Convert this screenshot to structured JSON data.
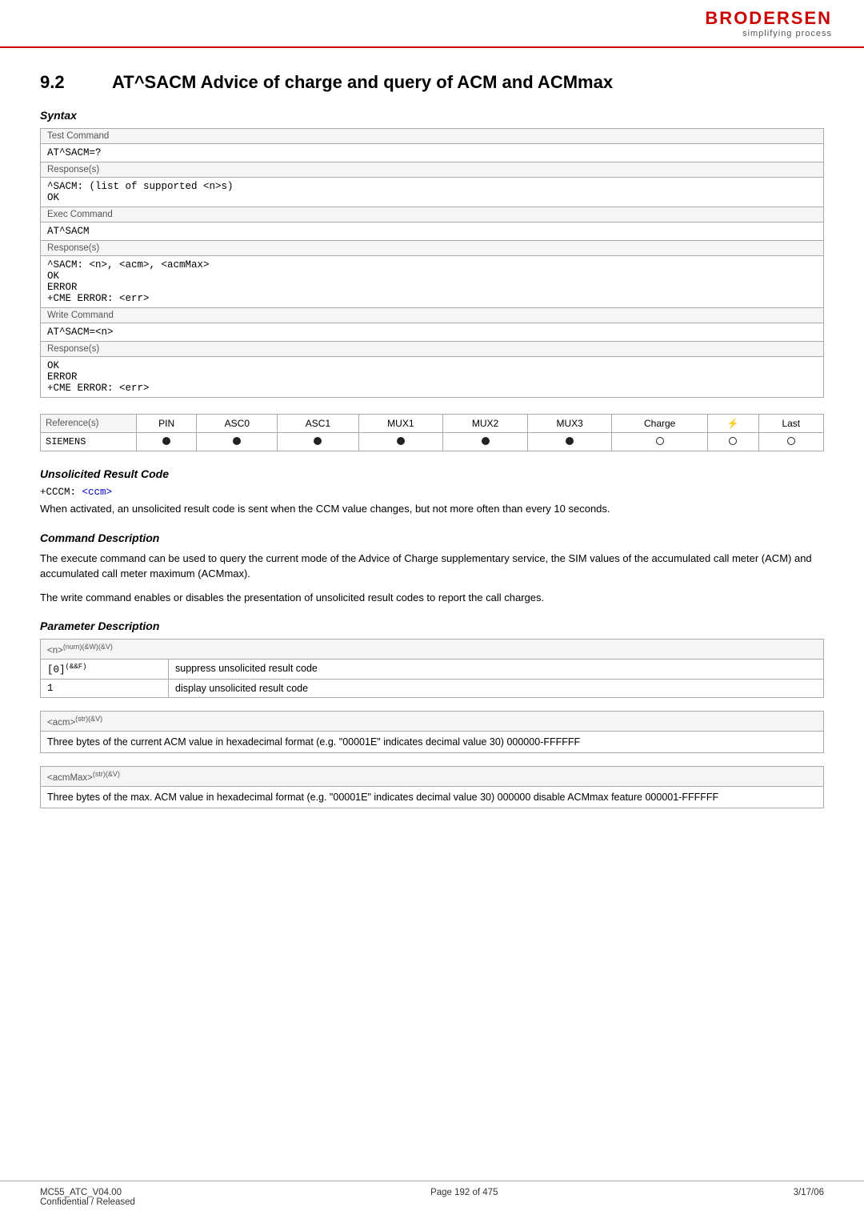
{
  "header": {
    "logo_name": "BRODERSEN",
    "logo_tagline": "simplifying process"
  },
  "section": {
    "number": "9.2",
    "title": "AT^SACM   Advice of charge and query of ACM and ACMmax"
  },
  "syntax": {
    "label": "Syntax",
    "test_command": {
      "label": "Test Command",
      "command": "AT^SACM=?",
      "responses_label": "Response(s)",
      "responses": [
        "^SACM: (list of supported <n>s)",
        "OK"
      ]
    },
    "exec_command": {
      "label": "Exec Command",
      "command": "AT^SACM",
      "responses_label": "Response(s)",
      "responses": [
        "^SACM: <n>, <acm>, <acmMax>",
        "OK",
        "ERROR",
        "+CME ERROR: <err>"
      ]
    },
    "write_command": {
      "label": "Write Command",
      "command": "AT^SACM=<n>",
      "responses_label": "Response(s)",
      "responses": [
        "OK",
        "ERROR",
        "+CME ERROR: <err>"
      ]
    }
  },
  "reference": {
    "label": "Reference(s)",
    "columns": [
      "PIN",
      "ASC0",
      "ASC1",
      "MUX1",
      "MUX2",
      "MUX3",
      "Charge",
      "⚡",
      "Last"
    ],
    "value": "SIEMENS",
    "dots": [
      "filled",
      "filled",
      "filled",
      "filled",
      "filled",
      "filled",
      "empty",
      "empty",
      "empty"
    ]
  },
  "unsolicited_result_code": {
    "label": "Unsolicited Result Code",
    "code": "+CCCM: <ccm>",
    "description": "When activated, an unsolicited result code is sent when the CCM value changes, but not more often than every 10 seconds."
  },
  "command_description": {
    "label": "Command Description",
    "paragraphs": [
      "The execute command can be used to query the current mode of the Advice of Charge supplementary service, the SIM values of the accumulated call meter (ACM) and accumulated call meter maximum (ACMmax).",
      "The write command enables or disables the presentation of unsolicited result codes to report the call charges."
    ]
  },
  "parameter_description": {
    "label": "Parameter Description",
    "params": [
      {
        "header": "<n>(num)(&W)(&V)",
        "values": [
          {
            "value": "[0](&&F)",
            "description": "suppress unsolicited result code"
          },
          {
            "value": "1",
            "description": "display unsolicited result code"
          }
        ]
      },
      {
        "header": "<acm>(str)(&V)",
        "values": [],
        "description": "Three bytes of the current ACM value in hexadecimal format (e.g. \"00001E\" indicates decimal value 30) 000000-FFFFFF"
      },
      {
        "header": "<acmMax>(str)(&V)",
        "values": [],
        "description": "Three bytes of the max. ACM value in hexadecimal format (e.g. \"00001E\" indicates decimal value 30) 000000 disable ACMmax feature 000001-FFFFFF"
      }
    ]
  },
  "footer": {
    "left_line1": "MC55_ATC_V04.00",
    "left_line2": "Confidential / Released",
    "center": "Page 192 of 475",
    "right": "3/17/06"
  }
}
